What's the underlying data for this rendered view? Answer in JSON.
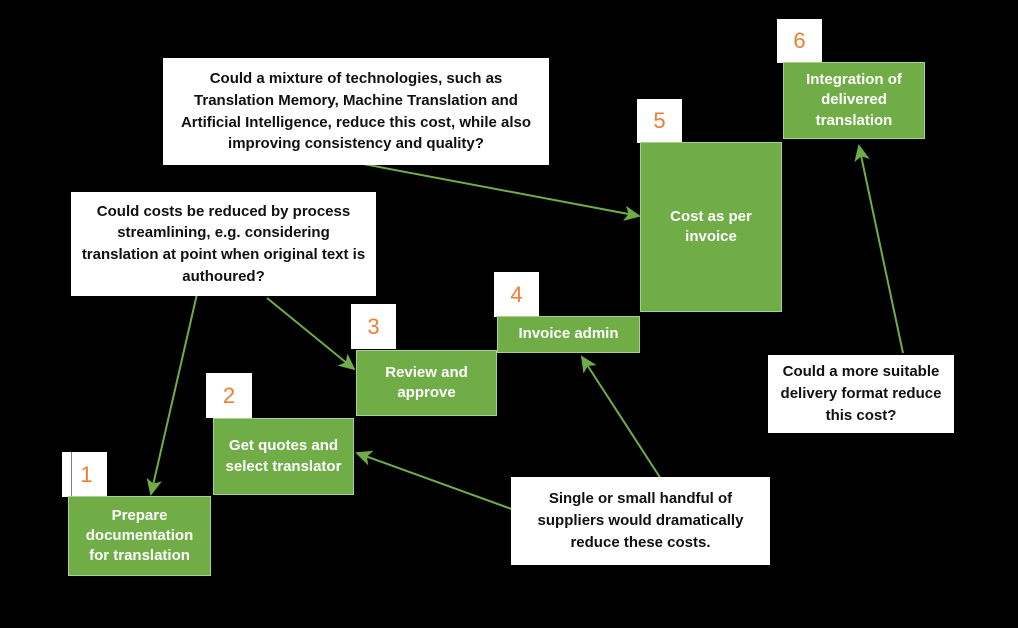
{
  "meta": {
    "background_color": "#000000",
    "process_box_color": "#70AD47",
    "process_box_border_color": "#A9D18E",
    "badge_number_color": "#ED7D31",
    "callout_background_color": "#FFFFFF",
    "callout_text_color": "#111111",
    "arrow_color": "#70AD47",
    "step_text_color": "#FFFFFF"
  },
  "steps": [
    {
      "number": "1",
      "label": "Prepare documentation for translation"
    },
    {
      "number": "2",
      "label": "Get quotes and select translator"
    },
    {
      "number": "3",
      "label": "Review and approve"
    },
    {
      "number": "4",
      "label": "Invoice admin"
    },
    {
      "number": "5",
      "label": "Cost as per invoice"
    },
    {
      "number": "6",
      "label": "Integration of delivered translation"
    }
  ],
  "callouts": [
    {
      "id": "technologies-mixture",
      "text": "Could a mixture of technologies, such as Translation Memory, Machine Translation and Artificial Intelligence, reduce this cost, while also improving consistency and quality?"
    },
    {
      "id": "process-streamlining",
      "text": "Could costs be reduced by process streamlining, e.g. considering translation at point when original text is authoured?"
    },
    {
      "id": "delivery-format",
      "text": "Could a more suitable delivery format reduce this cost?"
    },
    {
      "id": "supplier-consolidation",
      "text": "Single or small handful of suppliers would dramatically reduce these costs."
    }
  ],
  "connectors": [
    {
      "id": "streamlining-to-step1",
      "from": "process-streamlining",
      "to": "step-1"
    },
    {
      "id": "streamlining-to-step3",
      "from": "process-streamlining",
      "to": "step-3"
    },
    {
      "id": "technologies-to-step5",
      "from": "technologies-mixture",
      "to": "step-5"
    },
    {
      "id": "suppliers-to-step2",
      "from": "supplier-consolidation",
      "to": "step-2"
    },
    {
      "id": "suppliers-to-step4",
      "from": "supplier-consolidation",
      "to": "step-4"
    },
    {
      "id": "delivery-format-to-step6",
      "from": "delivery-format",
      "to": "step-6"
    }
  ]
}
